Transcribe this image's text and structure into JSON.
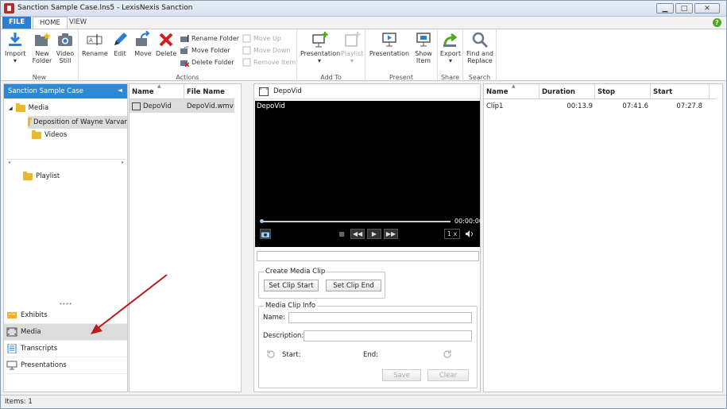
{
  "window": {
    "title": "Sanction Sample Case.lns5 - LexisNexis Sanction",
    "minimize": "▁",
    "maximize": "□",
    "close": "✕"
  },
  "tabs": {
    "file": "FILE",
    "home": "HOME",
    "view": "VIEW",
    "help": "?"
  },
  "ribbon": {
    "new": {
      "label": "New",
      "import": "Import",
      "new_folder": "New Folder",
      "video_still": "Video Still"
    },
    "actions": {
      "label": "Actions",
      "rename": "Rename",
      "edit": "Edit",
      "move": "Move",
      "delete": "Delete",
      "rename_folder": "Rename Folder",
      "move_folder": "Move Folder",
      "delete_folder": "Delete Folder",
      "move_up": "Move Up",
      "move_down": "Move Down",
      "remove_item": "Remove Item"
    },
    "add_to": {
      "label": "Add To",
      "presentation": "Presentation",
      "playlist": "Playlist"
    },
    "present": {
      "label": "Present",
      "presentation": "Presentation",
      "show_item": "Show Item"
    },
    "share": {
      "label": "Share",
      "export": "Export"
    },
    "search": {
      "label": "Search",
      "find_replace": "Find and Replace"
    }
  },
  "left_pane": {
    "title": "Sanction Sample Case",
    "collapse": "◄",
    "tree": {
      "expander": "◢",
      "media": "Media",
      "deposition": "Deposition of Wayne Varvar",
      "videos": "Videos",
      "playlist": "Playlist",
      "scroll_left": "◂",
      "scroll_right": "▸"
    },
    "splitter": "••••",
    "nav": {
      "exhibits": "Exhibits",
      "media": "Media",
      "transcripts": "Transcripts",
      "presentations": "Presentations"
    }
  },
  "file_pane": {
    "columns": {
      "name": "Name",
      "file_name": "File Name"
    },
    "rows": [
      {
        "name": "DepoVid",
        "file_name": "DepoVid.wmv"
      }
    ]
  },
  "player": {
    "header": "DepoVid",
    "video_label": "DepoVid",
    "timecode": "00:00:00",
    "speed": "1 x",
    "progress": 0.0,
    "controls": {
      "stop": "■",
      "rewind": "◀◀",
      "play": "▶",
      "forward": "▶▶",
      "volume": "🔊"
    },
    "create_clip": {
      "legend": "Create Media Clip",
      "set_start": "Set Clip Start",
      "set_end": "Set Clip End"
    },
    "clip_info": {
      "legend": "Media Clip Info",
      "name": "Name:",
      "description": "Description:",
      "start": "Start:",
      "end": "End:",
      "save": "Save",
      "clear": "Clear"
    }
  },
  "clip_list": {
    "columns": {
      "name": "Name",
      "duration": "Duration",
      "stop": "Stop",
      "start": "Start"
    },
    "rows": [
      {
        "name": "Clip1",
        "duration": "00:13.9",
        "stop": "07:41.6",
        "start": "07:27.8"
      }
    ]
  },
  "sort_indicator": "▲",
  "status": {
    "items": "Items: 1"
  },
  "colors": {
    "accent": "#2a8ad8",
    "file_tab": "#2a7fd4",
    "annotation_arrow": "#b81c1c"
  }
}
